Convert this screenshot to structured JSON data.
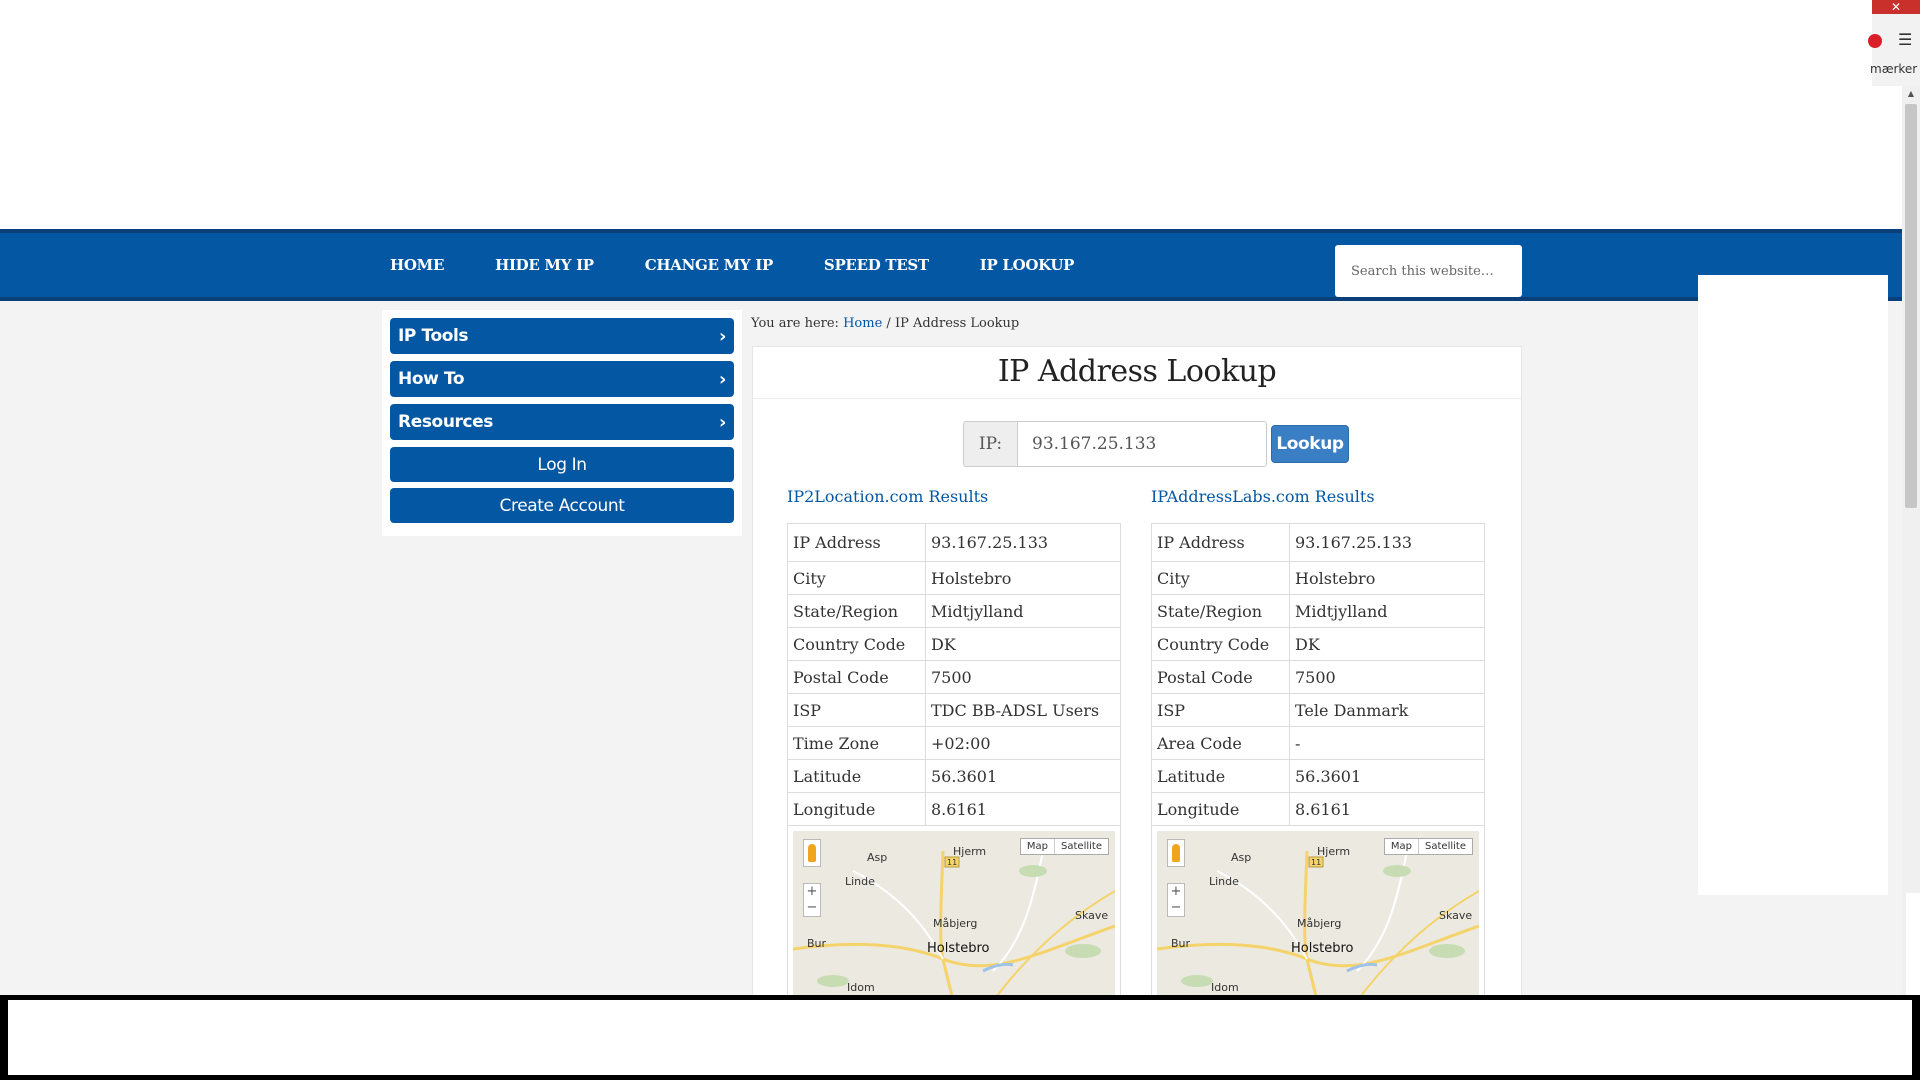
{
  "browser": {
    "close_glyph": "✕",
    "menu_glyph": "☰",
    "bookmarks_label": "mærker"
  },
  "nav": {
    "items": [
      "HOME",
      "HIDE MY IP",
      "CHANGE MY IP",
      "SPEED TEST",
      "IP LOOKUP"
    ],
    "search_placeholder": "Search this website…"
  },
  "sidebar": {
    "items": [
      "IP Tools",
      "How To",
      "Resources"
    ],
    "login_label": "Log In",
    "create_account_label": "Create Account"
  },
  "breadcrumb": {
    "prefix": "You are here:",
    "home": "Home",
    "separator": "/",
    "current": "IP Address Lookup"
  },
  "page": {
    "title": "IP Address Lookup"
  },
  "lookup": {
    "label": "IP:",
    "value": "93.167.25.133",
    "button_label": "Lookup"
  },
  "results": {
    "ip2location": {
      "heading": "IP2Location.com Results",
      "rows": [
        {
          "key": "IP Address",
          "value": "93.167.25.133"
        },
        {
          "key": "City",
          "value": "Holstebro"
        },
        {
          "key": "State/Region",
          "value": "Midtjylland"
        },
        {
          "key": "Country Code",
          "value": "DK"
        },
        {
          "key": "Postal Code",
          "value": "7500"
        },
        {
          "key": "ISP",
          "value": "TDC BB-ADSL Users"
        },
        {
          "key": "Time Zone",
          "value": "+02:00"
        },
        {
          "key": "Latitude",
          "value": "56.3601"
        },
        {
          "key": "Longitude",
          "value": "8.6161"
        }
      ]
    },
    "ipaddresslabs": {
      "heading": "IPAddressLabs.com Results",
      "rows": [
        {
          "key": "IP Address",
          "value": "93.167.25.133"
        },
        {
          "key": "City",
          "value": "Holstebro"
        },
        {
          "key": "State/Region",
          "value": "Midtjylland"
        },
        {
          "key": "Country Code",
          "value": "DK"
        },
        {
          "key": "Postal Code",
          "value": "7500"
        },
        {
          "key": "ISP",
          "value": "Tele Danmark"
        },
        {
          "key": "Area Code",
          "value": "-"
        },
        {
          "key": "Latitude",
          "value": "56.3601"
        },
        {
          "key": "Longitude",
          "value": "8.6161"
        }
      ]
    }
  },
  "map": {
    "type_map": "Map",
    "type_satellite": "Satellite",
    "zoom_in": "+",
    "zoom_out": "−",
    "road_marker": "11",
    "places": {
      "asp": "Asp",
      "hjerm": "Hjerm",
      "linde": "Linde",
      "mabjerg": "Måbjerg",
      "skave": "Skave",
      "bur": "Bur",
      "holstebro": "Holstebro",
      "idom": "Idom"
    }
  },
  "colors": {
    "brand_blue": "#0457a3",
    "link_blue": "#0457a3",
    "page_gray": "#f3f3f3"
  }
}
